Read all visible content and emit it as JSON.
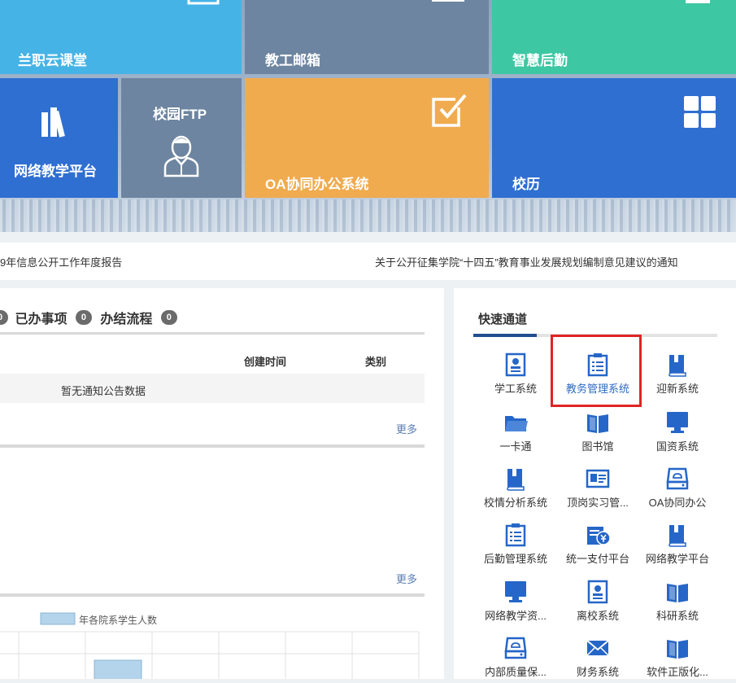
{
  "tiles": {
    "lanzhi_cloud": "兰职云课堂",
    "staff_mail": "教工邮箱",
    "smart_logistics": "智慧后勤",
    "network_platform": "网络教学平台",
    "campus_ftp": "校园FTP",
    "oa_system": "OA协同办公系统",
    "calendar": "校历"
  },
  "notices": {
    "left": "9年信息公开工作年度报告",
    "right": "关于公开征集学院“十四五”教育事业发展规划编制意见建议的通知"
  },
  "tasks": {
    "first_count": "0",
    "done_label": "已办事项",
    "done_count": "0",
    "closed_label": "办结流程",
    "closed_count": "0"
  },
  "table": {
    "col_created": "创建时间",
    "col_type": "类别",
    "empty_text": "暂无通知公告数据"
  },
  "more_label": "更多",
  "chart_data": {
    "type": "bar",
    "legend": [
      "年各院系学生人数"
    ],
    "series": [
      {
        "name": "年各院系学生人数",
        "values": []
      }
    ]
  },
  "quick": {
    "title": "快速通道",
    "items": [
      {
        "label": "学工系统",
        "icon": "id-card-icon"
      },
      {
        "label": "教务管理系统",
        "icon": "clipboard-list-icon"
      },
      {
        "label": "迎新系统",
        "icon": "book-icon"
      },
      {
        "label": "一卡通",
        "icon": "folder-icon"
      },
      {
        "label": "图书馆",
        "icon": "open-book-icon"
      },
      {
        "label": "国资系统",
        "icon": "monitor-icon"
      },
      {
        "label": "校情分析系统",
        "icon": "book-icon"
      },
      {
        "label": "顶岗实习管...",
        "icon": "id-badge-icon"
      },
      {
        "label": "OA协同办公",
        "icon": "cloud-drive-icon"
      },
      {
        "label": "后勤管理系统",
        "icon": "clipboard-list-icon"
      },
      {
        "label": "统一支付平台",
        "icon": "payment-icon"
      },
      {
        "label": "网络教学平台",
        "icon": "book-icon"
      },
      {
        "label": "网络教学资...",
        "icon": "monitor-icon"
      },
      {
        "label": "离校系统",
        "icon": "id-card-icon"
      },
      {
        "label": "科研系统",
        "icon": "open-book-icon"
      },
      {
        "label": "内部质量保...",
        "icon": "cloud-drive-icon"
      },
      {
        "label": "财务系统",
        "icon": "mail-icon"
      },
      {
        "label": "软件正版化...",
        "icon": "open-book-icon"
      }
    ]
  }
}
